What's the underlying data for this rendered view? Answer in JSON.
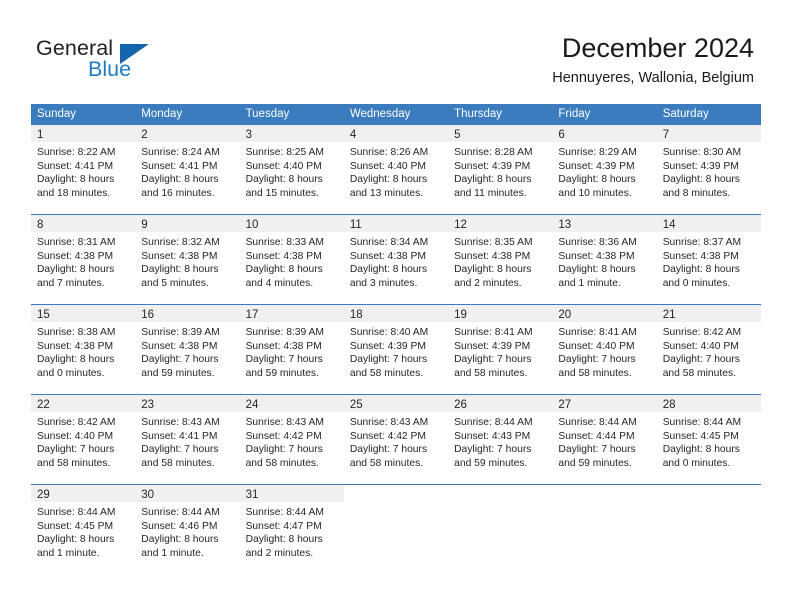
{
  "brand": {
    "name_part1": "General",
    "name_part2": "Blue",
    "triangle_color": "#1464ab",
    "blue_color": "#1f7ac4"
  },
  "header": {
    "title": "December 2024",
    "location": "Hennuyeres, Wallonia, Belgium"
  },
  "theme": {
    "header_blue": "#3a7cbe",
    "day_band_gray": "#f0f0f0",
    "text_color": "#262626"
  },
  "weekdays": [
    "Sunday",
    "Monday",
    "Tuesday",
    "Wednesday",
    "Thursday",
    "Friday",
    "Saturday"
  ],
  "weeks": [
    [
      {
        "day": "1",
        "sunrise": "Sunrise: 8:22 AM",
        "sunset": "Sunset: 4:41 PM",
        "daylight1": "Daylight: 8 hours",
        "daylight2": "and 18 minutes."
      },
      {
        "day": "2",
        "sunrise": "Sunrise: 8:24 AM",
        "sunset": "Sunset: 4:41 PM",
        "daylight1": "Daylight: 8 hours",
        "daylight2": "and 16 minutes."
      },
      {
        "day": "3",
        "sunrise": "Sunrise: 8:25 AM",
        "sunset": "Sunset: 4:40 PM",
        "daylight1": "Daylight: 8 hours",
        "daylight2": "and 15 minutes."
      },
      {
        "day": "4",
        "sunrise": "Sunrise: 8:26 AM",
        "sunset": "Sunset: 4:40 PM",
        "daylight1": "Daylight: 8 hours",
        "daylight2": "and 13 minutes."
      },
      {
        "day": "5",
        "sunrise": "Sunrise: 8:28 AM",
        "sunset": "Sunset: 4:39 PM",
        "daylight1": "Daylight: 8 hours",
        "daylight2": "and 11 minutes."
      },
      {
        "day": "6",
        "sunrise": "Sunrise: 8:29 AM",
        "sunset": "Sunset: 4:39 PM",
        "daylight1": "Daylight: 8 hours",
        "daylight2": "and 10 minutes."
      },
      {
        "day": "7",
        "sunrise": "Sunrise: 8:30 AM",
        "sunset": "Sunset: 4:39 PM",
        "daylight1": "Daylight: 8 hours",
        "daylight2": "and 8 minutes."
      }
    ],
    [
      {
        "day": "8",
        "sunrise": "Sunrise: 8:31 AM",
        "sunset": "Sunset: 4:38 PM",
        "daylight1": "Daylight: 8 hours",
        "daylight2": "and 7 minutes."
      },
      {
        "day": "9",
        "sunrise": "Sunrise: 8:32 AM",
        "sunset": "Sunset: 4:38 PM",
        "daylight1": "Daylight: 8 hours",
        "daylight2": "and 5 minutes."
      },
      {
        "day": "10",
        "sunrise": "Sunrise: 8:33 AM",
        "sunset": "Sunset: 4:38 PM",
        "daylight1": "Daylight: 8 hours",
        "daylight2": "and 4 minutes."
      },
      {
        "day": "11",
        "sunrise": "Sunrise: 8:34 AM",
        "sunset": "Sunset: 4:38 PM",
        "daylight1": "Daylight: 8 hours",
        "daylight2": "and 3 minutes."
      },
      {
        "day": "12",
        "sunrise": "Sunrise: 8:35 AM",
        "sunset": "Sunset: 4:38 PM",
        "daylight1": "Daylight: 8 hours",
        "daylight2": "and 2 minutes."
      },
      {
        "day": "13",
        "sunrise": "Sunrise: 8:36 AM",
        "sunset": "Sunset: 4:38 PM",
        "daylight1": "Daylight: 8 hours",
        "daylight2": "and 1 minute."
      },
      {
        "day": "14",
        "sunrise": "Sunrise: 8:37 AM",
        "sunset": "Sunset: 4:38 PM",
        "daylight1": "Daylight: 8 hours",
        "daylight2": "and 0 minutes."
      }
    ],
    [
      {
        "day": "15",
        "sunrise": "Sunrise: 8:38 AM",
        "sunset": "Sunset: 4:38 PM",
        "daylight1": "Daylight: 8 hours",
        "daylight2": "and 0 minutes."
      },
      {
        "day": "16",
        "sunrise": "Sunrise: 8:39 AM",
        "sunset": "Sunset: 4:38 PM",
        "daylight1": "Daylight: 7 hours",
        "daylight2": "and 59 minutes."
      },
      {
        "day": "17",
        "sunrise": "Sunrise: 8:39 AM",
        "sunset": "Sunset: 4:38 PM",
        "daylight1": "Daylight: 7 hours",
        "daylight2": "and 59 minutes."
      },
      {
        "day": "18",
        "sunrise": "Sunrise: 8:40 AM",
        "sunset": "Sunset: 4:39 PM",
        "daylight1": "Daylight: 7 hours",
        "daylight2": "and 58 minutes."
      },
      {
        "day": "19",
        "sunrise": "Sunrise: 8:41 AM",
        "sunset": "Sunset: 4:39 PM",
        "daylight1": "Daylight: 7 hours",
        "daylight2": "and 58 minutes."
      },
      {
        "day": "20",
        "sunrise": "Sunrise: 8:41 AM",
        "sunset": "Sunset: 4:40 PM",
        "daylight1": "Daylight: 7 hours",
        "daylight2": "and 58 minutes."
      },
      {
        "day": "21",
        "sunrise": "Sunrise: 8:42 AM",
        "sunset": "Sunset: 4:40 PM",
        "daylight1": "Daylight: 7 hours",
        "daylight2": "and 58 minutes."
      }
    ],
    [
      {
        "day": "22",
        "sunrise": "Sunrise: 8:42 AM",
        "sunset": "Sunset: 4:40 PM",
        "daylight1": "Daylight: 7 hours",
        "daylight2": "and 58 minutes."
      },
      {
        "day": "23",
        "sunrise": "Sunrise: 8:43 AM",
        "sunset": "Sunset: 4:41 PM",
        "daylight1": "Daylight: 7 hours",
        "daylight2": "and 58 minutes."
      },
      {
        "day": "24",
        "sunrise": "Sunrise: 8:43 AM",
        "sunset": "Sunset: 4:42 PM",
        "daylight1": "Daylight: 7 hours",
        "daylight2": "and 58 minutes."
      },
      {
        "day": "25",
        "sunrise": "Sunrise: 8:43 AM",
        "sunset": "Sunset: 4:42 PM",
        "daylight1": "Daylight: 7 hours",
        "daylight2": "and 58 minutes."
      },
      {
        "day": "26",
        "sunrise": "Sunrise: 8:44 AM",
        "sunset": "Sunset: 4:43 PM",
        "daylight1": "Daylight: 7 hours",
        "daylight2": "and 59 minutes."
      },
      {
        "day": "27",
        "sunrise": "Sunrise: 8:44 AM",
        "sunset": "Sunset: 4:44 PM",
        "daylight1": "Daylight: 7 hours",
        "daylight2": "and 59 minutes."
      },
      {
        "day": "28",
        "sunrise": "Sunrise: 8:44 AM",
        "sunset": "Sunset: 4:45 PM",
        "daylight1": "Daylight: 8 hours",
        "daylight2": "and 0 minutes."
      }
    ],
    [
      {
        "day": "29",
        "sunrise": "Sunrise: 8:44 AM",
        "sunset": "Sunset: 4:45 PM",
        "daylight1": "Daylight: 8 hours",
        "daylight2": "and 1 minute."
      },
      {
        "day": "30",
        "sunrise": "Sunrise: 8:44 AM",
        "sunset": "Sunset: 4:46 PM",
        "daylight1": "Daylight: 8 hours",
        "daylight2": "and 1 minute."
      },
      {
        "day": "31",
        "sunrise": "Sunrise: 8:44 AM",
        "sunset": "Sunset: 4:47 PM",
        "daylight1": "Daylight: 8 hours",
        "daylight2": "and 2 minutes."
      },
      {
        "day": "",
        "sunrise": "",
        "sunset": "",
        "daylight1": "",
        "daylight2": ""
      },
      {
        "day": "",
        "sunrise": "",
        "sunset": "",
        "daylight1": "",
        "daylight2": ""
      },
      {
        "day": "",
        "sunrise": "",
        "sunset": "",
        "daylight1": "",
        "daylight2": ""
      },
      {
        "day": "",
        "sunrise": "",
        "sunset": "",
        "daylight1": "",
        "daylight2": ""
      }
    ]
  ]
}
